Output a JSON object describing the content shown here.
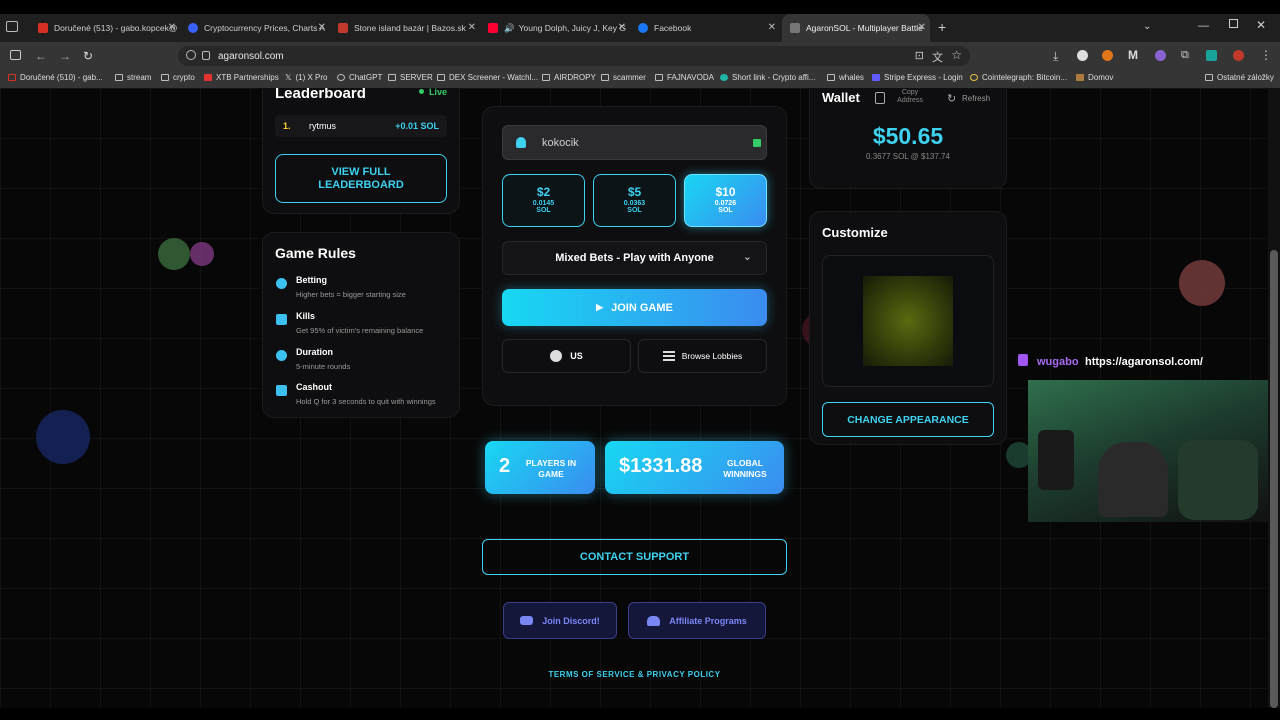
{
  "browser": {
    "tabs": [
      {
        "title": "Doručené (513) - gabo.kopcek@",
        "active": false
      },
      {
        "title": "Cryptocurrency Prices, Charts A",
        "active": false
      },
      {
        "title": "Stone island bazár | Bazos.sk",
        "active": false
      },
      {
        "title": "Young Dolph, Juicy J, Key G",
        "active": false
      },
      {
        "title": "Facebook",
        "active": false
      },
      {
        "title": "AgaronSOL - Multiplayer Battle",
        "active": true
      }
    ],
    "new_tab": "+",
    "url": "agaronsol.com",
    "bookmarks": [
      "Doručené (510) - gab...",
      "stream",
      "crypto",
      "XTB Partnerships",
      "(1) X Pro",
      "ChatGPT",
      "SERVER",
      "DEX Screener - Watchl...",
      "AIRDROPY",
      "scammer",
      "FAJNAVODA",
      "Short link - Crypto affi...",
      "whales",
      "Stripe Express - Login",
      "Cointelegraph: Bitcoin...",
      "Domov"
    ],
    "other_bookmarks": "Ostatné záložky"
  },
  "leaderboard": {
    "title": "Leaderboard",
    "live": "Live",
    "entries": [
      {
        "rank": "1.",
        "name": "rytmus",
        "amount": "+0.01 SOL"
      }
    ],
    "view_full": "VIEW FULL LEADERBOARD"
  },
  "rules": {
    "title": "Game Rules",
    "items": [
      {
        "title": "Betting",
        "desc": "Higher bets = bigger starting size"
      },
      {
        "title": "Kills",
        "desc": "Get 95% of victim's remaining balance"
      },
      {
        "title": "Duration",
        "desc": "5-minute rounds"
      },
      {
        "title": "Cashout",
        "desc": "Hold Q for 3 seconds to quit with winnings"
      }
    ]
  },
  "join": {
    "username": "kokocik",
    "bets": [
      {
        "usd": "$2",
        "sol": "0.0145",
        "unit": "SOL",
        "selected": false
      },
      {
        "usd": "$5",
        "sol": "0.0363",
        "unit": "SOL",
        "selected": false
      },
      {
        "usd": "$10",
        "sol": "0.0726",
        "unit": "SOL",
        "selected": true
      }
    ],
    "mode": "Mixed Bets - Play with Anyone",
    "join_button": "JOIN GAME",
    "region": "US",
    "browse": "Browse Lobbies"
  },
  "stats": {
    "players": "2",
    "players_label": "PLAYERS IN GAME",
    "winnings": "$1331.88",
    "winnings_label": "GLOBAL WINNINGS"
  },
  "contact": "CONTACT SUPPORT",
  "discord": "Join Discord!",
  "affiliate": "Affiliate Programs",
  "terms": "TERMS OF SERVICE & PRIVACY POLICY",
  "wallet": {
    "title": "Wallet",
    "copy": "Copy Address",
    "refresh": "Refresh",
    "balance": "$50.65",
    "sub": "0.3677 SOL @ $137.74"
  },
  "customize": {
    "title": "Customize",
    "button": "CHANGE APPEARANCE"
  },
  "stream": {
    "user": "wugabo",
    "link": "https://agaronsol.com/"
  },
  "colors": {
    "accent": "#3ed1f0",
    "button_gradient_start": "#17d8f2",
    "button_gradient_end": "#3b8cf0",
    "discord": "#5865f2"
  }
}
